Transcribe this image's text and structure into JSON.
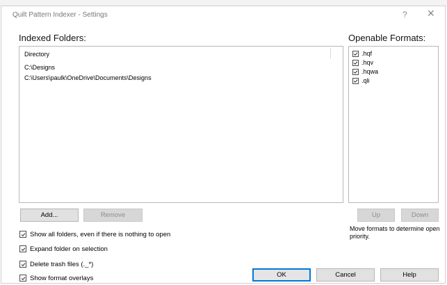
{
  "window": {
    "title": "Quilt Pattern Indexer - Settings",
    "help_glyph": "?",
    "close_glyph": "✕"
  },
  "folders": {
    "heading": "Indexed Folders:",
    "column_header": "Directory",
    "rows": [
      "C:\\Designs",
      "C:\\Users\\paulk\\OneDrive\\Documents\\Designs"
    ],
    "add_label": "Add...",
    "remove_label": "Remove"
  },
  "formats": {
    "heading": "Openable Formats:",
    "items": [
      {
        "label": ".hqf",
        "checked": true
      },
      {
        "label": ".hqv",
        "checked": true
      },
      {
        "label": ".hqwa",
        "checked": true
      },
      {
        "label": ".qli",
        "checked": true
      }
    ],
    "up_label": "Up",
    "down_label": "Down",
    "hint": "Move formats to determine open priority."
  },
  "options": [
    {
      "label": "Show all folders, even if there is nothing to open",
      "checked": true
    },
    {
      "label": "Expand folder on selection",
      "checked": true
    },
    {
      "label": "Delete trash files (._*)",
      "checked": true
    },
    {
      "label": "Show format overlays",
      "checked": true
    }
  ],
  "footer": {
    "ok_label": "OK",
    "cancel_label": "Cancel",
    "help_label": "Help"
  },
  "colors": {
    "accent": "#0078d7",
    "button_face": "#e1e1e1",
    "border": "#b8b8b8"
  }
}
